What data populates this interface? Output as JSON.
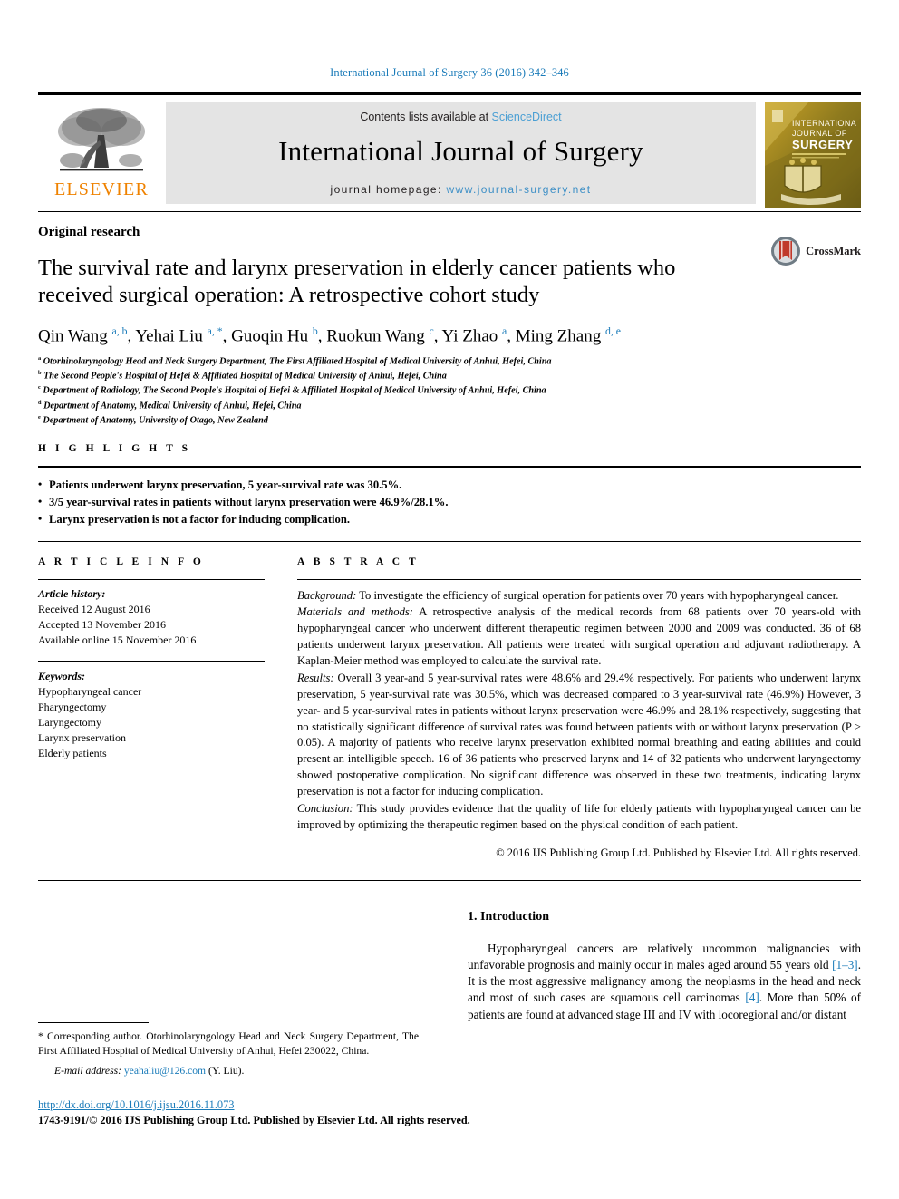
{
  "running_head": "International Journal of Surgery 36 (2016) 342–346",
  "masthead": {
    "publisher_logo_label": "ELSEVIER",
    "contents_prefix": "Contents lists available at ",
    "contents_link": "ScienceDirect",
    "journal_name": "International Journal of Surgery",
    "homepage_prefix": "journal homepage: ",
    "homepage_url": "www.journal-surgery.net",
    "cover_title_line1": "INTERNATIONAL",
    "cover_title_line2": "JOURNAL OF",
    "cover_title_line3": "SURGERY"
  },
  "article": {
    "kind": "Original research",
    "title": "The survival rate and larynx preservation in elderly cancer patients who received surgical operation: A retrospective cohort study",
    "crossmark_label": "CrossMark",
    "authors": [
      {
        "name": "Qin Wang",
        "sup": "a, b",
        "sep": ", "
      },
      {
        "name": "Yehai Liu",
        "sup": "a, *",
        "sep": ", "
      },
      {
        "name": "Guoqin Hu",
        "sup": "b",
        "sep": ", "
      },
      {
        "name": "Ruokun Wang",
        "sup": "c",
        "sep": ", "
      },
      {
        "name": "Yi Zhao",
        "sup": "a",
        "sep": ", "
      },
      {
        "name": "Ming Zhang",
        "sup": "d, e",
        "sep": ""
      }
    ],
    "affiliations": [
      {
        "mark": "a",
        "text": "Otorhinolaryngology Head and Neck Surgery Department, The First Affiliated Hospital of Medical University of Anhui, Hefei, China"
      },
      {
        "mark": "b",
        "text": "The Second People's Hospital of Hefei & Affiliated Hospital of Medical University of Anhui, Hefei, China"
      },
      {
        "mark": "c",
        "text": "Department of Radiology, The Second People's Hospital of Hefei & Affiliated Hospital of Medical University of Anhui, Hefei, China"
      },
      {
        "mark": "d",
        "text": "Department of Anatomy, Medical University of Anhui, Hefei, China"
      },
      {
        "mark": "e",
        "text": "Department of Anatomy, University of Otago, New Zealand"
      }
    ]
  },
  "highlights": {
    "label": "H I G H L I G H T S",
    "items": [
      "Patients underwent larynx preservation, 5 year-survival rate was 30.5%.",
      "3/5 year-survival rates in patients without larynx preservation were 46.9%/28.1%.",
      "Larynx preservation is not a factor for inducing complication."
    ]
  },
  "article_info": {
    "label": "A R T I C L E  I N F O",
    "history_label": "Article history:",
    "history": [
      "Received 12 August 2016",
      "Accepted 13 November 2016",
      "Available online 15 November 2016"
    ],
    "keywords_label": "Keywords:",
    "keywords": [
      "Hypopharyngeal cancer",
      "Pharyngectomy",
      "Laryngectomy",
      "Larynx preservation",
      "Elderly patients"
    ]
  },
  "abstract": {
    "label": "A B S T R A C T",
    "sections": [
      {
        "heading": "Background:",
        "text": " To investigate the efficiency of surgical operation for patients over 70 years with hypopharyngeal cancer."
      },
      {
        "heading": "Materials and methods:",
        "text": " A retrospective analysis of the medical records from 68 patients over 70 years-old with hypopharyngeal cancer who underwent different therapeutic regimen between 2000 and 2009 was conducted. 36 of 68 patients underwent larynx preservation. All patients were treated with surgical operation and adjuvant radiotherapy. A Kaplan-Meier method was employed to calculate the survival rate."
      },
      {
        "heading": "Results:",
        "text": " Overall 3 year-and 5 year-survival rates were 48.6% and 29.4% respectively. For patients who underwent larynx preservation, 5 year-survival rate was 30.5%, which was decreased compared to 3 year-survival rate (46.9%) However, 3 year- and 5 year-survival rates in patients without larynx preservation were 46.9% and 28.1% respectively, suggesting that no statistically significant difference of survival rates was found between patients with or without larynx preservation (P > 0.05). A majority of patients who receive larynx preservation exhibited normal breathing and eating abilities and could present an intelligible speech. 16 of 36 patients who preserved larynx and 14 of 32 patients who underwent laryngectomy showed postoperative complication. No significant difference was observed in these two treatments, indicating larynx preservation is not a factor for inducing complication."
      },
      {
        "heading": "Conclusion:",
        "text": " This study provides evidence that the quality of life for elderly patients with hypopharyngeal cancer can be improved by optimizing the therapeutic regimen based on the physical condition of each patient."
      }
    ],
    "copyright": "© 2016 IJS Publishing Group Ltd. Published by Elsevier Ltd. All rights reserved."
  },
  "body": {
    "intro_heading": "1. Introduction",
    "intro_part1": "Hypopharyngeal cancers are relatively uncommon malignancies with unfavorable prognosis and mainly occur in males aged around 55 years old ",
    "intro_ref1": "[1–3]",
    "intro_part2": ". It is the most aggressive malignancy among the neoplasms in the head and neck and most of such cases are squamous cell carcinomas ",
    "intro_ref2": "[4]",
    "intro_part3": ". More than 50% of patients are found at advanced stage III and IV with locoregional and/or distant"
  },
  "footnote": {
    "corresponding": "* Corresponding author. Otorhinolaryngology Head and Neck Surgery Department, The First Affiliated Hospital of Medical University of Anhui, Hefei 230022, China.",
    "email_label": "E-mail address:",
    "email": "yeahaliu@126.com",
    "email_suffix": "(Y. Liu)."
  },
  "footer": {
    "doi": "http://dx.doi.org/10.1016/j.ijsu.2016.11.073",
    "issn_line": "1743-9191/© 2016 IJS Publishing Group Ltd. Published by Elsevier Ltd. All rights reserved."
  }
}
